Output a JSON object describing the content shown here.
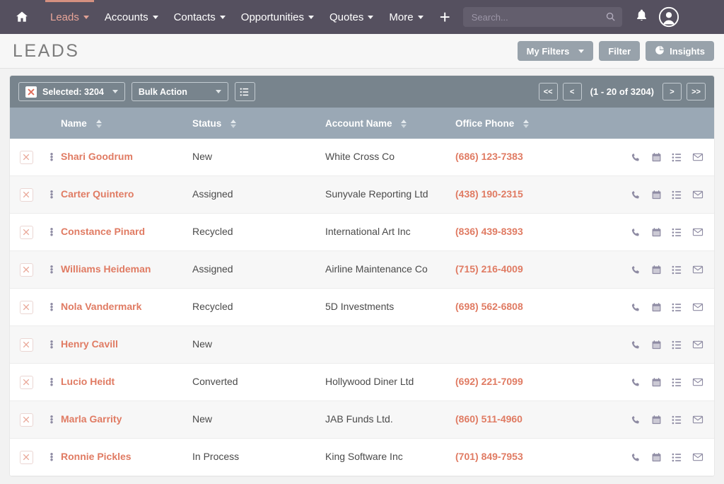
{
  "navbar": {
    "home_icon": "home-icon",
    "items": [
      {
        "label": "Leads",
        "active": true,
        "has_caret": true
      },
      {
        "label": "Accounts",
        "active": false,
        "has_caret": true
      },
      {
        "label": "Contacts",
        "active": false,
        "has_caret": true
      },
      {
        "label": "Opportunities",
        "active": false,
        "has_caret": true
      },
      {
        "label": "Quotes",
        "active": false,
        "has_caret": true
      },
      {
        "label": "More",
        "active": false,
        "has_caret": true
      }
    ],
    "plus_label": "+",
    "search": {
      "value": "",
      "placeholder": "Search..."
    },
    "bell_icon": "bell-icon",
    "avatar_icon": "user-avatar-icon",
    "background": "#55505f",
    "active_color": "#e8a598"
  },
  "page_header": {
    "title": "LEADS",
    "my_filters_label": "My Filters",
    "filter_label": "Filter",
    "insights_label": "Insights",
    "button_color": "#98a2ab"
  },
  "toolbar": {
    "selected_label": "Selected: 3204",
    "bulk_action_label": "Bulk Action",
    "list_view_icon": "list-view-icon",
    "background": "#78848d",
    "pagination": {
      "first_label": "<<",
      "prev_label": "<",
      "range_label": "(1 - 20 of 3204)",
      "next_label": ">",
      "last_label": ">>"
    }
  },
  "table": {
    "header_background": "#9aa8b5",
    "columns": [
      {
        "label": "Name",
        "sortable": true
      },
      {
        "label": "Status",
        "sortable": true
      },
      {
        "label": "Account Name",
        "sortable": true
      },
      {
        "label": "Office Phone",
        "sortable": true
      }
    ],
    "row_actions": [
      "phone-icon",
      "calendar-icon",
      "list-icon",
      "envelope-icon"
    ],
    "accent_color": "#e07b63",
    "rows": [
      {
        "name": "Shari Goodrum",
        "status": "New",
        "account": "White Cross Co",
        "phone": "(686) 123-7383"
      },
      {
        "name": "Carter Quintero",
        "status": "Assigned",
        "account": "Sunyvale Reporting Ltd",
        "phone": "(438) 190-2315"
      },
      {
        "name": "Constance Pinard",
        "status": "Recycled",
        "account": "International Art Inc",
        "phone": "(836) 439-8393"
      },
      {
        "name": "Williams Heideman",
        "status": "Assigned",
        "account": "Airline Maintenance Co",
        "phone": "(715) 216-4009"
      },
      {
        "name": "Nola Vandermark",
        "status": "Recycled",
        "account": "5D Investments",
        "phone": "(698) 562-6808"
      },
      {
        "name": "Henry Cavill",
        "status": "New",
        "account": "",
        "phone": ""
      },
      {
        "name": "Lucio Heidt",
        "status": "Converted",
        "account": "Hollywood Diner Ltd",
        "phone": "(692) 221-7099"
      },
      {
        "name": "Marla Garrity",
        "status": "New",
        "account": "JAB Funds Ltd.",
        "phone": "(860) 511-4960"
      },
      {
        "name": "Ronnie Pickles",
        "status": "In Process",
        "account": "King Software Inc",
        "phone": "(701) 849-7953"
      }
    ]
  }
}
